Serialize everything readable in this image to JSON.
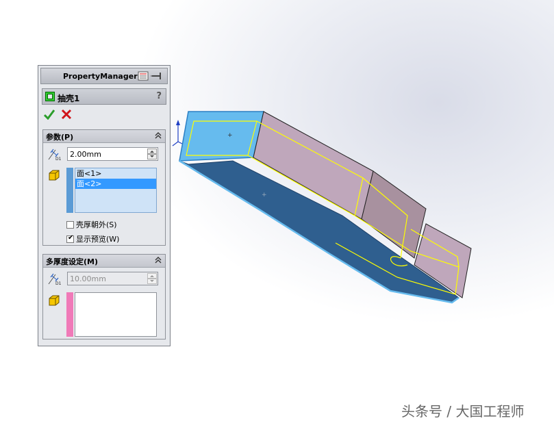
{
  "property_manager": {
    "title": "PropertyManager",
    "feature_name": "抽壳1",
    "help_label": "?",
    "parameters": {
      "header": "参数(P)",
      "thickness": "2.00mm",
      "faces": [
        "面<1>",
        "面<2>"
      ],
      "selected_face_index": 1,
      "shell_outward_label": "壳厚朝外(S)",
      "shell_outward_checked": false,
      "show_preview_label": "显示预览(W)",
      "show_preview_checked": true
    },
    "multi_thickness": {
      "header": "多厚度设定(M)",
      "thickness": "10.00mm",
      "faces": []
    }
  },
  "watermark": "头条号 / 大国工程师",
  "colors": {
    "selection_blue": "#3399ff",
    "face_list_bg": "#cfe3f7",
    "blue_bar": "#5b9bd5",
    "pink_bar": "#f07ab8",
    "model_top": "#66bbee",
    "model_side": "#bfa7bb",
    "outline": "#ffff00"
  },
  "icons": [
    "pin-icon",
    "shell-feature-icon",
    "help-icon",
    "ok-check-icon",
    "cancel-x-icon",
    "collapse-chevron-icon",
    "dimension-icon",
    "face-cube-icon"
  ]
}
